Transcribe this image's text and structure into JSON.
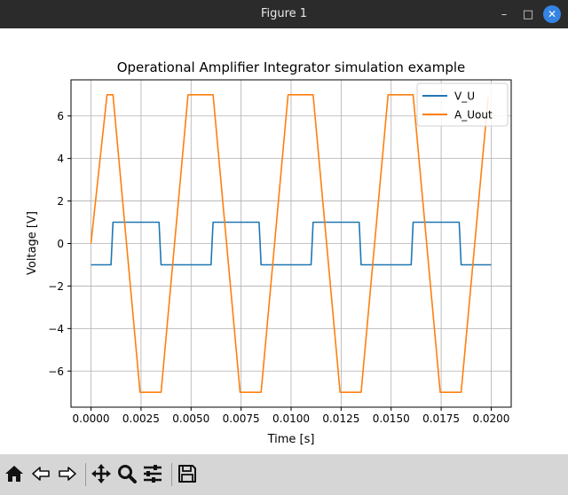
{
  "window": {
    "title": "Figure 1"
  },
  "toolbar": {
    "tools": [
      {
        "name": "home-button",
        "icon": "home-icon"
      },
      {
        "name": "back-button",
        "icon": "arrow-left-icon"
      },
      {
        "name": "forward-button",
        "icon": "arrow-right-icon"
      },
      {
        "name": "pan-button",
        "icon": "move-icon"
      },
      {
        "name": "zoom-button",
        "icon": "magnifier-icon"
      },
      {
        "name": "subplots-button",
        "icon": "sliders-icon"
      },
      {
        "name": "save-button",
        "icon": "floppy-icon"
      }
    ]
  },
  "chart_data": {
    "type": "line",
    "title": "Operational Amplifier Integrator simulation example",
    "xlabel": "Time [s]",
    "ylabel": "Voltage [V]",
    "xlim": [
      -0.001,
      0.021
    ],
    "ylim": [
      -7.7,
      7.7
    ],
    "xticks": [
      0,
      0.0025,
      0.005,
      0.0075,
      0.01,
      0.0125,
      0.015,
      0.0175,
      0.02
    ],
    "xtick_labels": [
      "0.0000",
      "0.0025",
      "0.0050",
      "0.0075",
      "0.0100",
      "0.0125",
      "0.0150",
      "0.0175",
      "0.0200"
    ],
    "yticks": [
      -6,
      -4,
      -2,
      0,
      2,
      4,
      6
    ],
    "ytick_labels": [
      "−6",
      "−4",
      "−2",
      "0",
      "2",
      "4",
      "6"
    ],
    "grid": true,
    "legend_position": "top-right",
    "series": [
      {
        "name": "V_U",
        "color": "#1f77b4",
        "x": [
          0,
          0.001,
          0.00105,
          0.0011,
          0.0034,
          0.00345,
          0.0035,
          0.006,
          0.00605,
          0.0061,
          0.0084,
          0.00845,
          0.0085,
          0.011,
          0.01105,
          0.0111,
          0.0134,
          0.01345,
          0.0135,
          0.016,
          0.01605,
          0.0161,
          0.0184,
          0.01845,
          0.0185,
          0.02
        ],
        "y": [
          -1,
          -1,
          0,
          1,
          1,
          0,
          -1,
          -1,
          0,
          1,
          1,
          0,
          -1,
          -1,
          0,
          1,
          1,
          0,
          -1,
          -1,
          0,
          1,
          1,
          0,
          -1,
          -1
        ]
      },
      {
        "name": "A_Uout",
        "color": "#ff7f0e",
        "x": [
          0,
          0.0008,
          0.0011,
          0.00245,
          0.0035,
          0.00485,
          0.0061,
          0.00745,
          0.0085,
          0.00985,
          0.0111,
          0.01245,
          0.0135,
          0.01485,
          0.0161,
          0.01745,
          0.0185,
          0.01985
        ],
        "y": [
          0,
          7,
          7,
          -7,
          -7,
          7,
          7,
          -7,
          -7,
          7,
          7,
          -7,
          -7,
          7,
          7,
          -7,
          -7,
          6.9
        ]
      }
    ]
  }
}
